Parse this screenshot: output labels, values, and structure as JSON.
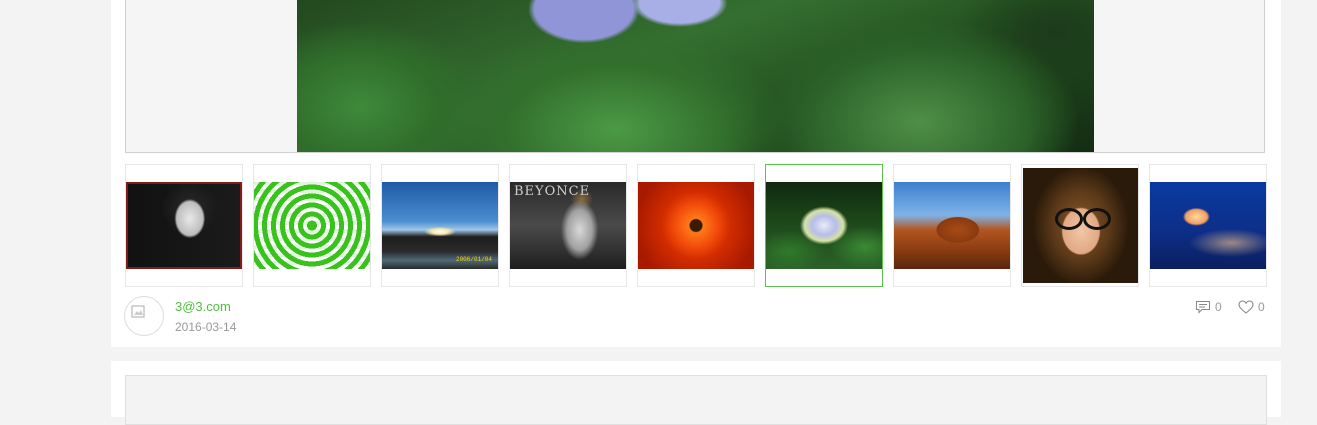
{
  "post": {
    "author": "3@3.com",
    "date": "2016-03-14",
    "comments": "0",
    "likes": "0",
    "thumbnails": [
      {
        "name": "thumb-audrey",
        "subject": "Audrey Hepburn portrait"
      },
      {
        "name": "thumb-green-squares",
        "subject": "green concentric squares"
      },
      {
        "name": "thumb-sunset",
        "subject": "sunset landscape",
        "stamp": "2006/01/04"
      },
      {
        "name": "thumb-beyonce",
        "subject": "Beyonce photo",
        "overlay": "BEYONCE"
      },
      {
        "name": "thumb-chrysanthemum",
        "subject": "orange chrysanthemum"
      },
      {
        "name": "thumb-hydrangea",
        "subject": "hydrangea flowers",
        "active": true
      },
      {
        "name": "thumb-desert",
        "subject": "desert mesa"
      },
      {
        "name": "thumb-girl",
        "subject": "girl with glasses"
      },
      {
        "name": "thumb-jellyfish",
        "subject": "jellyfish"
      }
    ]
  },
  "colors": {
    "accent": "#4fbf3f",
    "active_border": "#5bc14a",
    "muted": "#999999"
  },
  "icons": {
    "comments": "comment-icon",
    "likes": "heart-icon",
    "avatar": "broken-image-icon"
  }
}
